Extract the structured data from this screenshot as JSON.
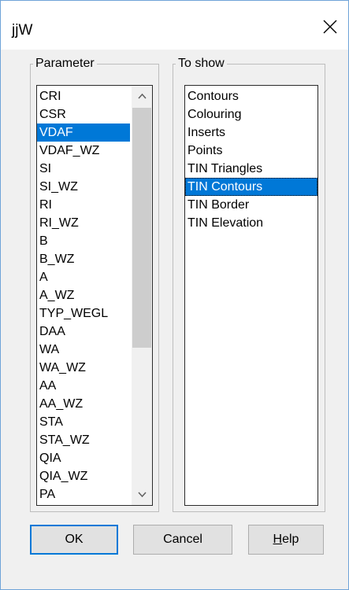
{
  "window": {
    "title": "jjW",
    "close_icon": "close-icon"
  },
  "parameter_group": {
    "label": "Parameter",
    "items": [
      "CRI",
      "CSR",
      "VDAF",
      "VDAF_WZ",
      "SI",
      "SI_WZ",
      "RI",
      "RI_WZ",
      "B",
      "B_WZ",
      "A",
      "A_WZ",
      "TYP_WEGL",
      "DAA",
      "WA",
      "WA_WZ",
      "AA",
      "AA_WZ",
      "STA",
      "STA_WZ",
      "QIA",
      "QIA_WZ",
      "PA"
    ],
    "selected": "VDAF",
    "scroll_up_icon": "chevron-up-icon",
    "scroll_down_icon": "chevron-down-icon"
  },
  "to_show_group": {
    "label": "To show",
    "items": [
      "Contours",
      "Colouring",
      "Inserts",
      "Points",
      "TIN Triangles",
      "TIN Contours",
      "TIN Border",
      "TIN Elevation"
    ],
    "selected": "TIN Contours"
  },
  "buttons": {
    "ok": "OK",
    "cancel": "Cancel",
    "help_first": "H",
    "help_rest": "elp"
  },
  "colors": {
    "selection": "#0078d7",
    "dialog_bg": "#f0f0f0",
    "accent_border": "#0078d7"
  }
}
